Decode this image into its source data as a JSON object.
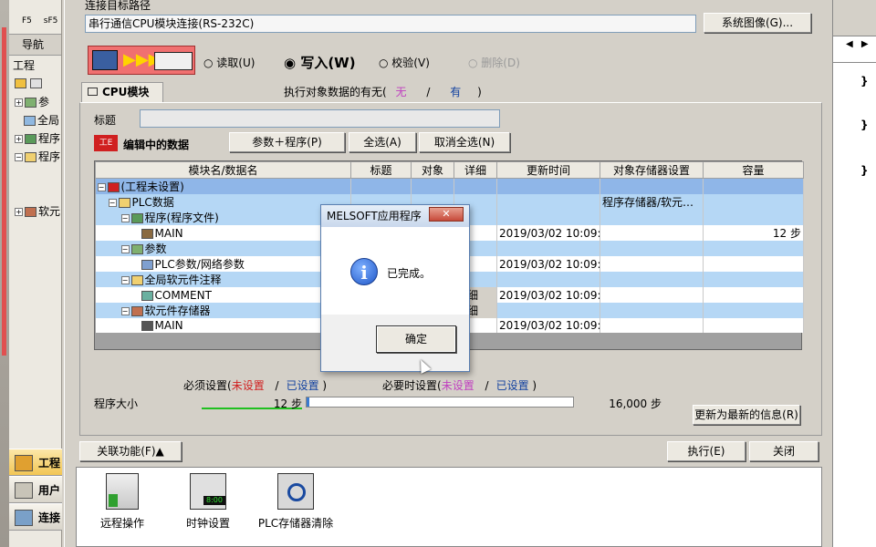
{
  "nav": {
    "toolbar_glyphs": [
      "F5",
      "sF5"
    ],
    "title": "导航",
    "section": "工程",
    "tree_items": [
      "参",
      "全局",
      "程序",
      "程序",
      "软元"
    ],
    "bottom_buttons": [
      "工程",
      "用户",
      "连接"
    ]
  },
  "main": {
    "path_label": "连接目标路径",
    "path_value": "串行通信CPU模块连接(RS-232C)",
    "system_image_button": "系统图像(G)...",
    "radio_read": "读取(U)",
    "radio_write": "写入(W)",
    "radio_verify": "校验(V)",
    "radio_delete": "删除(D)",
    "tab_cpu": "CPU模块",
    "exec_data_label": "执行对象数据的有无(",
    "exec_none": "无",
    "exec_slash": "/",
    "exec_have": "有",
    "exec_close": ")",
    "title_label": "标题",
    "title_value": "",
    "editing_label": "编辑中的数据",
    "param_program_button": "参数＋程序(P)",
    "select_all_button": "全选(A)",
    "deselect_all_button": "取消全选(N)",
    "table_headers": [
      "模块名/数据名",
      "标题",
      "对象",
      "详细",
      "更新时间",
      "对象存储器设置",
      "容量"
    ],
    "table_rows": [
      {
        "name": "(工程未设置)",
        "title": "",
        "time": "",
        "mem": "",
        "cap": ""
      },
      {
        "name": "PLC数据",
        "title": "",
        "time": "",
        "mem": "程序存储器/软元…",
        "cap": ""
      },
      {
        "name": "程序(程序文件)",
        "title": "",
        "time": "",
        "mem": "",
        "cap": ""
      },
      {
        "name": "MAIN",
        "title": "",
        "time": "2019/03/02 10:09:12",
        "mem": "",
        "cap": "12 步"
      },
      {
        "name": "参数",
        "title": "",
        "time": "",
        "mem": "",
        "cap": ""
      },
      {
        "name": "PLC参数/网络参数",
        "title": "",
        "time": "2019/03/02 10:09:11",
        "mem": "",
        "cap": ""
      },
      {
        "name": "全局软元件注释",
        "title": "",
        "time": "",
        "mem": "",
        "cap": ""
      },
      {
        "name": "COMMENT",
        "title": "",
        "time": "2019/03/02 10:09:12",
        "mem": "",
        "cap": ""
      },
      {
        "name": "软元件存储器",
        "title": "",
        "time": "",
        "mem": "",
        "cap": ""
      },
      {
        "name": "MAIN",
        "title": "",
        "time": "2019/03/02 10:09:12",
        "mem": "",
        "cap": ""
      }
    ],
    "detail_button_label": "详细",
    "required_label": "必须设置(",
    "not_set": "未设置",
    "slash": "/",
    "set": "已设置",
    "close_paren": ")",
    "when_required_label": "必要时设置(",
    "program_size_label": "程序大小",
    "program_size_value": "12 步",
    "program_size_fraction": 0.00075,
    "capacity_value": "16,000 步",
    "refresh_button": "更新为最新的信息(R)",
    "related_button": "关联功能(F)▲",
    "execute_button": "执行(E)",
    "close_button": "关闭",
    "related_items": [
      "远程操作",
      "时钟设置",
      "PLC存储器清除"
    ],
    "clock_display": "8:00"
  },
  "dialog": {
    "title": "MELSOFT应用程序",
    "close_glyph": "✕",
    "message": "已完成。",
    "ok_button": "确定"
  },
  "right_panel": {
    "glyphs": [
      "◀",
      "▶",
      "}",
      "}",
      "}"
    ]
  }
}
